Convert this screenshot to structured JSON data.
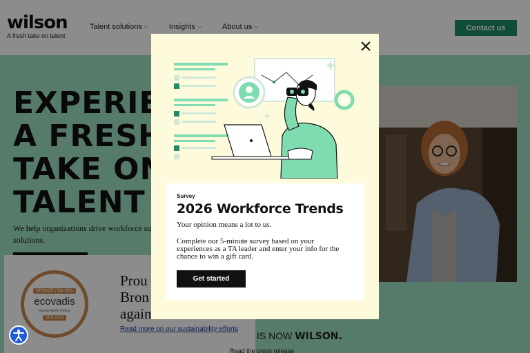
{
  "header": {
    "logo": "wilson",
    "tagline": "A fresh take on talent",
    "nav": [
      {
        "label": "Talent solutions"
      },
      {
        "label": "Insights"
      },
      {
        "label": "About us"
      }
    ],
    "contact_label": "Contact us"
  },
  "hero": {
    "title_lines": [
      "EXPERIE",
      "A FRESH",
      "TAKE ON",
      "TALENT"
    ],
    "subtitle": "We help organizations drive workforce su solutions."
  },
  "eco": {
    "badge_top": "BRONZE | Top 35%",
    "badge_name": "ecovadis",
    "badge_rating": "Sustainability Rating",
    "badge_date": "SEP 2025",
    "text_lines": [
      "Prou",
      "Bron",
      "again"
    ],
    "link": "Read more on our sustainability efforts"
  },
  "announce": {
    "prefix": "IS NOW",
    "brand": "WILSON.",
    "press": "Read the press release"
  },
  "modal": {
    "kicker": "Survey",
    "title": "2026 Workforce Trends",
    "p1": "Your opinion means a lot to us.",
    "p2": "Complete our 5-minute survey based on your experiences as a TA leader and enter your info for the chance to win a gift card.",
    "cta": "Get started"
  },
  "colors": {
    "accent": "#1e8a6a",
    "hero_bg": "#9fe0c3",
    "modal_bg": "#fdfbdc",
    "illustration_green": "#7fdcb0"
  }
}
